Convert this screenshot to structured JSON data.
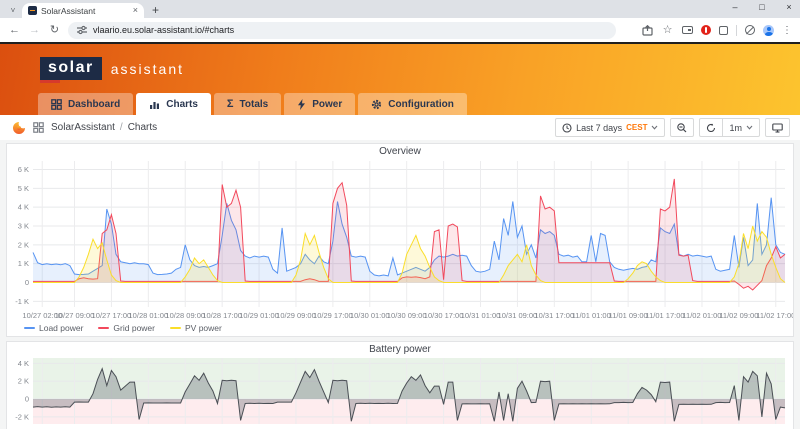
{
  "browser": {
    "tab_title": "SolarAssistant",
    "url": "vlaario.eu.solar-assistant.io/#charts",
    "glyphs": {
      "back": "←",
      "forward": "→",
      "reload": "↻",
      "star": "☆",
      "menu": "⋮",
      "minimize": "–",
      "maximize": "□",
      "close": "×",
      "tab_close": "×",
      "new_tab": "+",
      "tab_search": "˅"
    }
  },
  "header": {
    "logo_primary": "solar",
    "logo_secondary": "assistant",
    "accent_color": "#d63a2c"
  },
  "nav": {
    "tabs": [
      {
        "label": "Dashboard",
        "icon": "grid-icon",
        "active": false
      },
      {
        "label": "Charts",
        "icon": "chart-icon",
        "active": true
      },
      {
        "label": "Totals",
        "icon": "sigma-icon",
        "sigma": "Σ",
        "active": false
      },
      {
        "label": "Power",
        "icon": "lightning-icon",
        "active": false
      },
      {
        "label": "Configuration",
        "icon": "gear-icon",
        "active": false
      }
    ]
  },
  "breadcrumb": {
    "app": "SolarAssistant",
    "separator": "/",
    "page": "Charts"
  },
  "controls": {
    "time_range": "Last 7 days",
    "timezone": "CEST",
    "refresh_interval": "1m",
    "icons": [
      "clock-icon",
      "zoom-out-icon",
      "refresh-icon",
      "monitor-icon",
      "grafana-logo",
      "grid-icon"
    ]
  },
  "chart_data": [
    {
      "type": "line",
      "title": "Overview",
      "x_unit": "hours since 10/27 00:00, 1h step",
      "x_max": 163,
      "ylim": [
        -1300,
        6450
      ],
      "y_ticks": [
        {
          "v": 6000,
          "label": "6 K"
        },
        {
          "v": 5000,
          "label": "5 K"
        },
        {
          "v": 4000,
          "label": "4 K"
        },
        {
          "v": 3000,
          "label": "3 K"
        },
        {
          "v": 2000,
          "label": "2 K"
        },
        {
          "v": 1000,
          "label": "1 K"
        },
        {
          "v": 0,
          "label": "0"
        },
        {
          "v": -1000,
          "label": "-1 K"
        }
      ],
      "x_ticks": [
        {
          "h": 2,
          "label": "10/27 02:00"
        },
        {
          "h": 9,
          "label": "10/27 09:00"
        },
        {
          "h": 17,
          "label": "10/27 17:00"
        },
        {
          "h": 25,
          "label": "10/28 01:00"
        },
        {
          "h": 33,
          "label": "10/28 09:00"
        },
        {
          "h": 41,
          "label": "10/28 17:00"
        },
        {
          "h": 49,
          "label": "10/29 01:00"
        },
        {
          "h": 57,
          "label": "10/29 09:00"
        },
        {
          "h": 65,
          "label": "10/29 17:00"
        },
        {
          "h": 73,
          "label": "10/30 01:00"
        },
        {
          "h": 81,
          "label": "10/30 09:00"
        },
        {
          "h": 89,
          "label": "10/30 17:00"
        },
        {
          "h": 97,
          "label": "10/31 01:00"
        },
        {
          "h": 105,
          "label": "10/31 09:00"
        },
        {
          "h": 113,
          "label": "10/31 17:00"
        },
        {
          "h": 121,
          "label": "11/01 01:00"
        },
        {
          "h": 129,
          "label": "11/01 09:00"
        },
        {
          "h": 137,
          "label": "11/01 17:00"
        },
        {
          "h": 145,
          "label": "11/02 01:00"
        },
        {
          "h": 153,
          "label": "11/02 09:00"
        },
        {
          "h": 161,
          "label": "11/02 17:00"
        }
      ],
      "series": [
        {
          "name": "Load power",
          "color": "#5794F2",
          "fill": "rgba(87,148,242,0.14)",
          "values": [
            1600,
            1050,
            950,
            1000,
            950,
            980,
            940,
            1000,
            900,
            450,
            420,
            430,
            450,
            600,
            750,
            900,
            3900,
            3100,
            1500,
            1100,
            1050,
            1000,
            1050,
            1000,
            1000,
            950,
            500,
            420,
            430,
            450,
            500,
            700,
            800,
            2000,
            1200,
            900,
            800,
            850,
            800,
            900,
            1000,
            2500,
            4200,
            3300,
            2800,
            1700,
            1400,
            1300,
            1400,
            1350,
            1400,
            1350,
            700,
            500,
            2900,
            600,
            700,
            800,
            1000,
            1500,
            1200,
            1000,
            1400,
            1100,
            1000,
            2200,
            4300,
            3100,
            2400,
            1400,
            1350,
            1400,
            1350,
            600,
            400,
            350,
            400,
            350,
            1300,
            400,
            500,
            600,
            700,
            800,
            700,
            600,
            800,
            1200,
            1400,
            1350,
            1400,
            1500,
            1400,
            1450,
            1400,
            900,
            600,
            550,
            600,
            700,
            2200,
            1200,
            3400,
            2500,
            4300,
            2400,
            3000,
            1500,
            2000,
            1300,
            2800,
            2600,
            2700,
            2500,
            1500,
            1400,
            1450,
            1350,
            1400,
            1100,
            1100,
            2500,
            1100,
            2600,
            2500,
            1100,
            800,
            700,
            650,
            700,
            750,
            700,
            800,
            850,
            1200,
            1100,
            2900,
            2700,
            2600,
            3100,
            1500,
            1400,
            1500,
            1400,
            1450,
            1400,
            1350,
            1400,
            700,
            600,
            650,
            700,
            2500,
            800,
            2400,
            900,
            1200,
            4200,
            1500,
            2000,
            4500,
            2000,
            1600,
            1500
          ]
        },
        {
          "name": "Grid power",
          "color": "#F2495C",
          "fill": "rgba(242,73,92,0.13)",
          "values": [
            60,
            60,
            60,
            60,
            60,
            60,
            60,
            60,
            60,
            60,
            200,
            250,
            200,
            180,
            200,
            2600,
            2800,
            3600,
            2600,
            80,
            60,
            60,
            60,
            60,
            60,
            60,
            60,
            60,
            60,
            60,
            60,
            60,
            60,
            60,
            60,
            60,
            60,
            60,
            60,
            60,
            60,
            5200,
            4000,
            4200,
            4900,
            4000,
            80,
            60,
            60,
            60,
            60,
            60,
            60,
            60,
            60,
            60,
            60,
            60,
            60,
            150,
            200,
            150,
            60,
            60,
            60,
            4200,
            5000,
            5300,
            4100,
            80,
            60,
            60,
            60,
            60,
            60,
            60,
            60,
            60,
            60,
            60,
            250,
            300,
            280,
            300,
            260,
            200,
            300,
            2700,
            2800,
            150,
            3000,
            3100,
            2950,
            100,
            60,
            60,
            60,
            60,
            60,
            60,
            60,
            60,
            60,
            60,
            60,
            60,
            60,
            60,
            60,
            60,
            4600,
            3900,
            4000,
            3800,
            1050,
            1050,
            1050,
            1050,
            1050,
            1050,
            1050,
            1050,
            1050,
            1050,
            1050,
            1050,
            80,
            60,
            60,
            60,
            60,
            60,
            60,
            60,
            60,
            60,
            3900,
            3800,
            4000,
            5500,
            1450,
            1400,
            1450,
            100,
            60,
            60,
            60,
            60,
            60,
            60,
            60,
            60,
            80,
            -100,
            -300,
            -200,
            -400,
            -150,
            100,
            900,
            1300,
            1900,
            1300,
            1500
          ]
        },
        {
          "name": "PV power",
          "color": "#FADE2A",
          "fill": "rgba(250,222,42,0.18)",
          "values": [
            0,
            0,
            0,
            0,
            0,
            0,
            0,
            0,
            0,
            0,
            300,
            800,
            1500,
            2300,
            1800,
            2100,
            1200,
            400,
            100,
            0,
            0,
            0,
            0,
            0,
            0,
            0,
            0,
            0,
            0,
            0,
            0,
            0,
            0,
            300,
            700,
            1300,
            1000,
            1200,
            800,
            400,
            100,
            0,
            0,
            0,
            0,
            0,
            0,
            0,
            0,
            0,
            0,
            0,
            0,
            0,
            0,
            0,
            0,
            400,
            1200,
            2600,
            2000,
            2500,
            1600,
            800,
            200,
            0,
            0,
            0,
            0,
            0,
            0,
            0,
            0,
            0,
            0,
            0,
            0,
            0,
            0,
            0,
            500,
            1500,
            2000,
            2500,
            1800,
            1400,
            800,
            300,
            100,
            0,
            0,
            0,
            0,
            0,
            0,
            0,
            0,
            0,
            0,
            0,
            0,
            0,
            400,
            900,
            1200,
            1500,
            1100,
            2000,
            900,
            400,
            100,
            0,
            0,
            0,
            0,
            0,
            0,
            0,
            0,
            0,
            0,
            0,
            0,
            0,
            0,
            0,
            0,
            0,
            0,
            200,
            500,
            900,
            1100,
            1000,
            600,
            300,
            100,
            0,
            0,
            0,
            0,
            0,
            0,
            0,
            0,
            0,
            0,
            0,
            0,
            0,
            0,
            0,
            300,
            1000,
            2600,
            1800,
            3000,
            2200,
            2700,
            2400,
            1500,
            800,
            200,
            0
          ]
        }
      ]
    },
    {
      "type": "line",
      "title": "Battery power",
      "x_unit": "hours since 10/27 00:00, 1h step",
      "x_max": 163,
      "ylim": [
        -2800,
        4600
      ],
      "y_ticks": [
        {
          "v": 4000,
          "label": "4 K"
        },
        {
          "v": 2000,
          "label": "2 K"
        },
        {
          "v": 0,
          "label": "0"
        },
        {
          "v": -2000,
          "label": "-2 K"
        }
      ],
      "x_ticks": [
        {
          "h": 2
        },
        {
          "h": 9
        },
        {
          "h": 17
        },
        {
          "h": 25
        },
        {
          "h": 33
        },
        {
          "h": 41
        },
        {
          "h": 49
        },
        {
          "h": 57
        },
        {
          "h": 65
        },
        {
          "h": 73
        },
        {
          "h": 81
        },
        {
          "h": 89
        },
        {
          "h": 97
        },
        {
          "h": 105
        },
        {
          "h": 113
        },
        {
          "h": 121
        },
        {
          "h": 129
        },
        {
          "h": 137
        },
        {
          "h": 145
        },
        {
          "h": 153
        },
        {
          "h": 161
        }
      ],
      "zones": [
        {
          "from": 0,
          "to": "max",
          "color": "rgba(86,166,75,0.13)"
        },
        {
          "from": "min",
          "to": 0,
          "color": "rgba(242,73,92,0.10)"
        }
      ],
      "series": [
        {
          "name": "Battery power",
          "color": "#4a4f55",
          "fill": "rgba(74,81,89,0.30)",
          "values": [
            -900,
            -850,
            -900,
            -870,
            -920,
            -880,
            -900,
            -860,
            -900,
            -350,
            -330,
            -350,
            -340,
            600,
            2200,
            3400,
            1500,
            3200,
            2500,
            1000,
            1450,
            1900,
            1900,
            -2300,
            -450,
            -430,
            -450,
            -440,
            -450,
            -430,
            -450,
            -440,
            -450,
            800,
            1700,
            2600,
            2100,
            2900,
            1800,
            900,
            -500,
            2100,
            2050,
            2100,
            2050,
            -2400,
            -500,
            -480,
            -500,
            -480,
            -500,
            -490,
            -500,
            -350,
            -340,
            -350,
            -340,
            700,
            1900,
            3100,
            2400,
            3300,
            2000,
            800,
            -400,
            2100,
            2050,
            2100,
            2050,
            -2500,
            -500,
            -480,
            -500,
            -480,
            -500,
            -490,
            -500,
            -480,
            -500,
            -490,
            900,
            1800,
            2500,
            2100,
            2700,
            1500,
            700,
            1450,
            1450,
            -600,
            1900,
            1900,
            -2400,
            -550,
            -530,
            -550,
            -550,
            -530,
            -550,
            -540,
            -2500,
            800,
            -2400,
            600,
            -2500,
            1200,
            2000,
            900,
            -400,
            -380,
            2000,
            1950,
            2000,
            -2400,
            -550,
            -530,
            -550,
            -540,
            -550,
            -530,
            -550,
            -540,
            -550,
            -530,
            -550,
            -540,
            -400,
            -400,
            -380,
            -400,
            -390,
            600,
            1300,
            1000,
            500,
            -300,
            1900,
            1850,
            1900,
            -2500,
            -600,
            -580,
            -600,
            -590,
            -600,
            -580,
            -600,
            -590,
            -400,
            -380,
            -400,
            -390,
            1500,
            -2400,
            2500,
            1900,
            3100,
            2600,
            -2000,
            2900,
            1700,
            -2300,
            -900,
            -1000
          ]
        }
      ]
    }
  ]
}
